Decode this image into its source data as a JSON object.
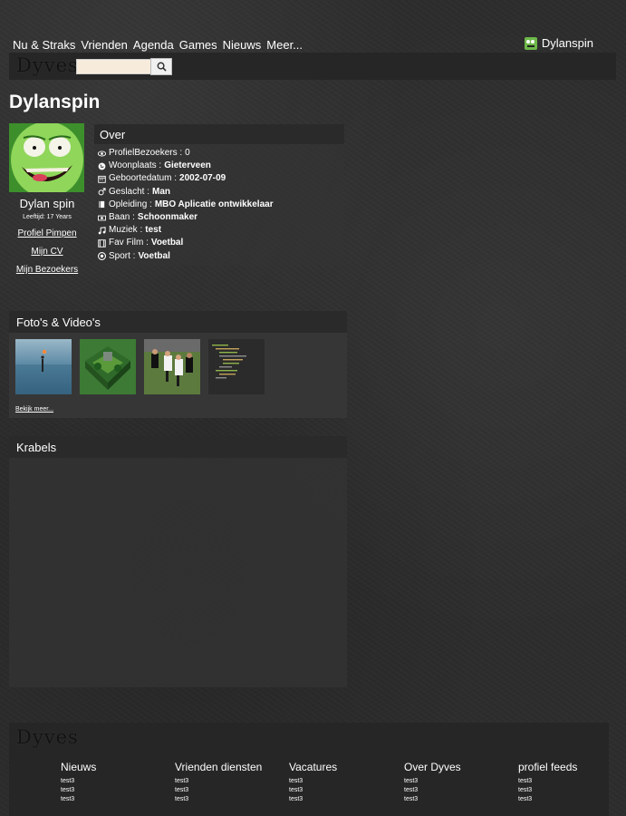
{
  "nav": {
    "items": [
      "Nu & Straks",
      "Vrienden",
      "Agenda",
      "Games",
      "Nieuws",
      "Meer..."
    ]
  },
  "user": {
    "name": "Dylanspin"
  },
  "brand": {
    "logo": "Dyves"
  },
  "search": {
    "placeholder": "",
    "value": ""
  },
  "profile": {
    "page_title": "Dylanspin",
    "display_name": "Dylan spin",
    "age": "Leeftijd: 17 Years",
    "links": [
      "Profiel Pimpen",
      "Mijn CV",
      "Mijn Bezoekers"
    ]
  },
  "over": {
    "title": "Over",
    "rows": [
      {
        "icon": "eye-icon",
        "label": "ProfielBezoekers : ",
        "value": "0",
        "bold": false
      },
      {
        "icon": "globe-icon",
        "label": "Woonplaats : ",
        "value": "Gieterveen",
        "bold": true
      },
      {
        "icon": "calendar-icon",
        "label": "Geboortedatum : ",
        "value": "2002-07-09",
        "bold": true
      },
      {
        "icon": "male-icon",
        "label": "Geslacht : ",
        "value": "Man",
        "bold": true
      },
      {
        "icon": "book-icon",
        "label": "Opleiding : ",
        "value": "MBO Aplicatie ontwikkelaar",
        "bold": true
      },
      {
        "icon": "money-icon",
        "label": "Baan : ",
        "value": "Schoonmaker",
        "bold": true
      },
      {
        "icon": "music-icon",
        "label": "Muziek : ",
        "value": "test",
        "bold": true
      },
      {
        "icon": "film-icon",
        "label": "Fav Film : ",
        "value": "Voetbal",
        "bold": true
      },
      {
        "icon": "soccer-ball-icon",
        "label": "Sport : ",
        "value": "Voetbal",
        "bold": true
      }
    ]
  },
  "photos": {
    "title": "Foto's & Video's",
    "more": "Bekijk meer...",
    "thumbs": [
      "sea-photo",
      "lego-diorama-photo",
      "rugby-photo",
      "code-screenshot-photo"
    ]
  },
  "krabels": {
    "title": "Krabels"
  },
  "footer": {
    "logo": "Dyves",
    "columns": [
      {
        "title": "Nieuws",
        "items": [
          "test3",
          "test3",
          "test3"
        ]
      },
      {
        "title": "Vrienden diensten",
        "items": [
          "test3",
          "test3",
          "test3"
        ]
      },
      {
        "title": "Vacatures",
        "items": [
          "test3",
          "test3",
          "test3"
        ]
      },
      {
        "title": "Over Dyves",
        "items": [
          "test3",
          "test3",
          "test3"
        ]
      },
      {
        "title": "profiel feeds",
        "items": [
          "test3",
          "test3",
          "test3"
        ]
      }
    ]
  }
}
